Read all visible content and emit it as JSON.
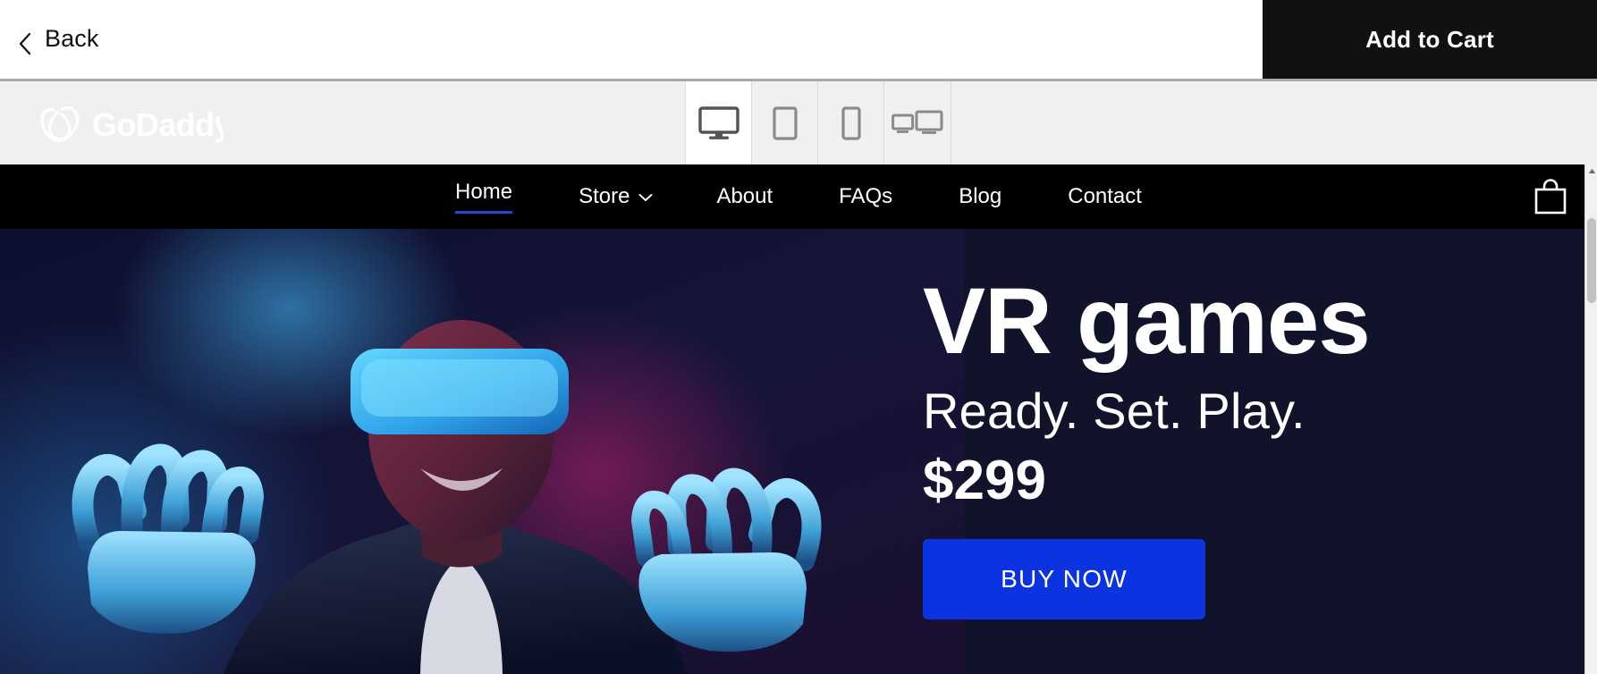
{
  "editor": {
    "back_label": "Back",
    "back_icon": "chevron-left-icon",
    "add_to_cart_label": "Add to Cart"
  },
  "brand": {
    "name": "GoDaddy",
    "logo_icon": "godaddy-logo"
  },
  "device_tabs": [
    {
      "id": "desktop",
      "icon": "desktop-monitor-icon",
      "label": "Desktop",
      "active": true
    },
    {
      "id": "tablet",
      "icon": "tablet-icon",
      "label": "Tablet",
      "active": false
    },
    {
      "id": "phone",
      "icon": "mobile-phone-icon",
      "label": "Phone",
      "active": false
    },
    {
      "id": "responsive",
      "icon": "multi-device-icon",
      "label": "Responsive",
      "active": false
    }
  ],
  "site": {
    "nav": {
      "items": [
        {
          "label": "Home",
          "active": true,
          "has_dropdown": false
        },
        {
          "label": "Store",
          "active": false,
          "has_dropdown": true
        },
        {
          "label": "About",
          "active": false,
          "has_dropdown": false
        },
        {
          "label": "FAQs",
          "active": false,
          "has_dropdown": false
        },
        {
          "label": "Blog",
          "active": false,
          "has_dropdown": false
        },
        {
          "label": "Contact",
          "active": false,
          "has_dropdown": false
        }
      ],
      "cart_icon": "shopping-bag-icon",
      "background_color": "#000000",
      "active_underline_color": "#1f4bd8"
    },
    "hero": {
      "title": "VR games",
      "subtitle": "Ready. Set. Play.",
      "price": "$299",
      "cta_label": "BUY NOW",
      "cta_color": "#0b33e0",
      "background_color": "#11132a",
      "image_alt": "Man wearing a VR headset reaching out with both hands, lit by blue and magenta neon light"
    }
  },
  "scrollbar": {
    "up_arrow_icon": "caret-up-icon",
    "thumb_label": "vertical-scroll-thumb"
  }
}
